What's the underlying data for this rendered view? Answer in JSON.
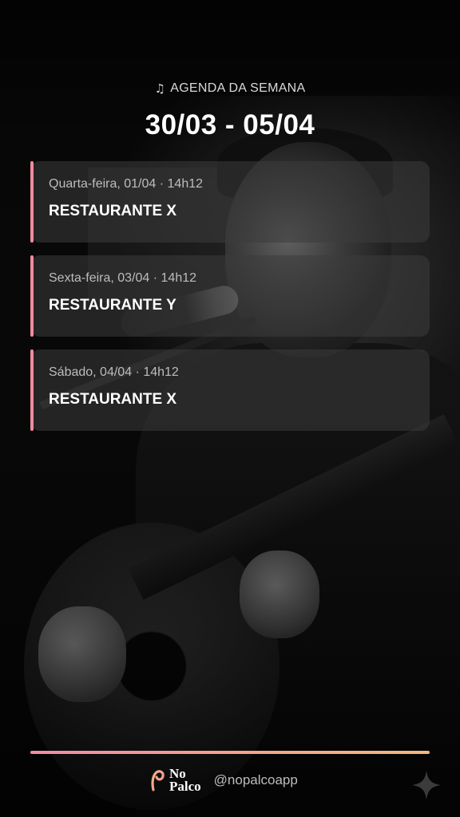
{
  "header": {
    "eyebrow_icon": "music-note-icon",
    "eyebrow": "AGENDA DA SEMANA",
    "week_range": "30/03 - 05/04"
  },
  "events": [
    {
      "date": "Quarta-feira, 01/04 · 14h12",
      "venue": "RESTAURANTE X"
    },
    {
      "date": "Sexta-feira, 03/04 · 14h12",
      "venue": "RESTAURANTE Y"
    },
    {
      "date": "Sábado, 04/04 · 14h12",
      "venue": "RESTAURANTE X"
    }
  ],
  "footer": {
    "logo_line1": "No",
    "logo_line2": "Palco",
    "handle": "@nopalcoapp",
    "sparkle_icon": "sparkle-icon"
  },
  "colors": {
    "accent": "#f08aa0",
    "gradient_start": "#f38aa5",
    "gradient_end": "#f7b77a"
  }
}
